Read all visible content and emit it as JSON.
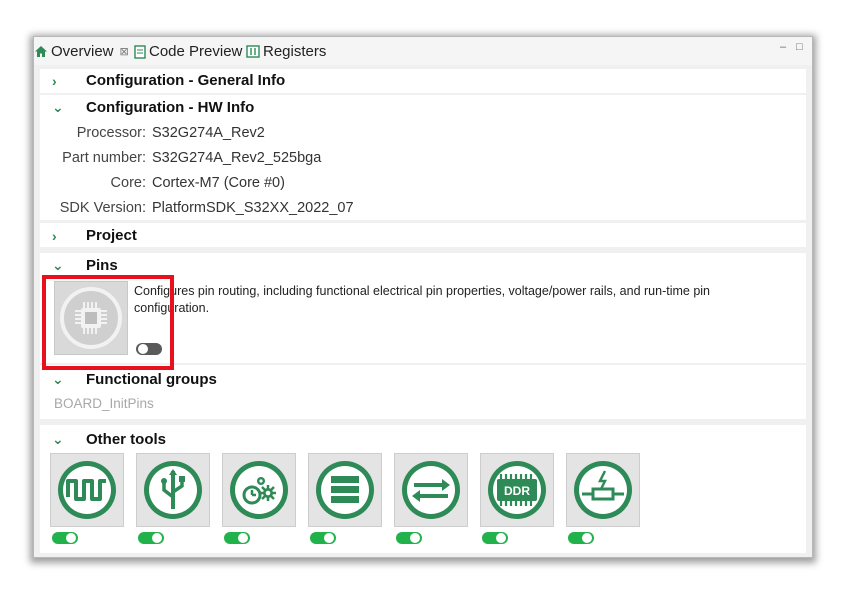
{
  "tabs": [
    {
      "label": "Overview",
      "icon": "house-icon",
      "close": "⊠"
    },
    {
      "label": "Code Preview",
      "icon": "document-icon"
    },
    {
      "label": "Registers",
      "icon": "registers-icon"
    }
  ],
  "window_controls": {
    "minimize": "–",
    "maximize": "□"
  },
  "sections": {
    "general_info": {
      "title": "Configuration - General Info"
    },
    "hw_info": {
      "title": "Configuration - HW Info",
      "rows": [
        {
          "label": "Processor:",
          "value": "S32G274A_Rev2"
        },
        {
          "label": "Part number:",
          "value": "S32G274A_Rev2_525bga"
        },
        {
          "label": "Core:",
          "value": "Cortex-M7 (Core #0)"
        },
        {
          "label": "SDK Version:",
          "value": "PlatformSDK_S32XX_2022_07"
        }
      ]
    },
    "project": {
      "title": "Project"
    },
    "pins": {
      "title": "Pins",
      "description_line1": "Configures pin routing, including functional  electrical pin properties, voltage/power rails, and run-time pin",
      "description_line2": "configuration.",
      "icon": "chip-icon",
      "enabled": false
    },
    "functional_groups": {
      "title": "Functional groups",
      "item": "BOARD_InitPins"
    },
    "other_tools": {
      "title": "Other tools",
      "tools": [
        {
          "icon": "clocks-wave-icon",
          "enabled": true
        },
        {
          "icon": "usb-icon",
          "enabled": true
        },
        {
          "icon": "peripherals-gear-icon",
          "enabled": true
        },
        {
          "icon": "stack-layers-icon",
          "enabled": true
        },
        {
          "icon": "swap-arrows-icon",
          "enabled": true
        },
        {
          "icon": "ddr-icon",
          "label": "DDR",
          "enabled": true
        },
        {
          "icon": "resistor-icon",
          "enabled": true
        }
      ]
    }
  },
  "colors": {
    "accent_green": "#2e8b57",
    "toggle_on": "#22b24c",
    "toggle_off": "#5a5a5a",
    "highlight": "#e8101a"
  }
}
